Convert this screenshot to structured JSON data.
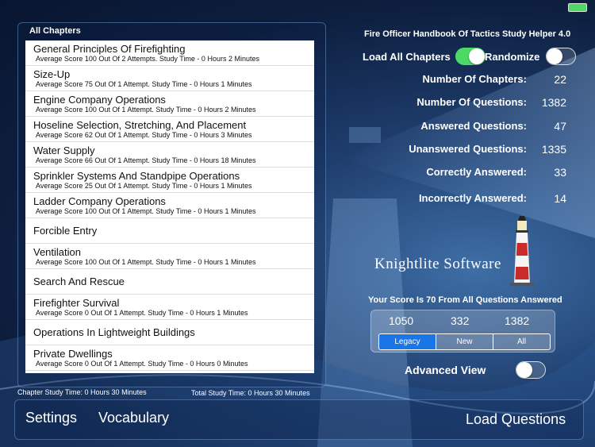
{
  "left_panel": {
    "title": "All Chapters",
    "chapters": [
      {
        "name": "General Principles Of Firefighting",
        "detail": "Average Score 100 Out Of 2 Attempts. Study Time - 0 Hours 2 Minutes"
      },
      {
        "name": "Size-Up",
        "detail": "Average Score 75 Out Of 1 Attempt. Study Time - 0 Hours 1 Minutes"
      },
      {
        "name": "Engine Company Operations",
        "detail": "Average Score 100 Out Of 1 Attempt. Study Time - 0 Hours 2 Minutes"
      },
      {
        "name": "Hoseline Selection, Stretching, And Placement",
        "detail": "Average Score 62 Out Of 1 Attempt. Study Time - 0 Hours 3 Minutes"
      },
      {
        "name": "Water Supply",
        "detail": "Average Score 66 Out Of 1 Attempt. Study Time - 0 Hours 18 Minutes"
      },
      {
        "name": "Sprinkler Systems And Standpipe Operations",
        "detail": "Average Score 25 Out Of 1 Attempt. Study Time - 0 Hours 1 Minutes"
      },
      {
        "name": "Ladder Company Operations",
        "detail": "Average Score 100 Out Of 1 Attempt. Study Time - 0 Hours 1 Minutes"
      },
      {
        "name": "Forcible Entry",
        "detail": ""
      },
      {
        "name": "Ventilation",
        "detail": "Average Score 100 Out Of 1 Attempt. Study Time - 0 Hours 1 Minutes"
      },
      {
        "name": "Search And Rescue",
        "detail": ""
      },
      {
        "name": "Firefighter Survival",
        "detail": "Average Score 0 Out Of 1 Attempt. Study Time - 0 Hours 1 Minutes"
      },
      {
        "name": "Operations In Lightweight Buildings",
        "detail": ""
      },
      {
        "name": "Private Dwellings",
        "detail": "Average Score 0 Out Of 1 Attempt. Study Time - 0 Hours 0 Minutes"
      }
    ],
    "chapter_study_time": "Chapter Study Time: 0 Hours 30 Minutes",
    "total_study_time": "Total Study Time: 0 Hours 30 Minutes"
  },
  "right_panel": {
    "app_title": "Fire Officer Handbook Of Tactics Study Helper 4.0",
    "load_all_chapters_label": "Load All Chapters",
    "load_all_chapters_on": true,
    "randomize_label": "Randomize",
    "randomize_on": false,
    "stats": [
      {
        "label": "Number Of Chapters:",
        "value": "22"
      },
      {
        "label": "Number Of Questions:",
        "value": "1382"
      },
      {
        "label": "Answered Questions:",
        "value": "47"
      },
      {
        "label": "Unanswered Questions:",
        "value": "1335"
      },
      {
        "label": "Correctly Answered:",
        "value": "33"
      },
      {
        "label": "Incorrectly Answered:",
        "value": "14"
      }
    ],
    "brand": "Knightlite Software",
    "score_text": "Your Score Is 70 From All Questions Answered",
    "counts": [
      "1050",
      "332",
      "1382"
    ],
    "segments": [
      "Legacy",
      "New",
      "All"
    ],
    "active_segment": "Legacy",
    "advanced_view_label": "Advanced View",
    "advanced_view_on": false
  },
  "bottom_bar": {
    "settings_label": "Settings",
    "vocabulary_label": "Vocabulary",
    "load_questions_label": "Load Questions"
  },
  "colors": {
    "accent": "#1a75e6",
    "toggle_on": "#4cd964"
  }
}
